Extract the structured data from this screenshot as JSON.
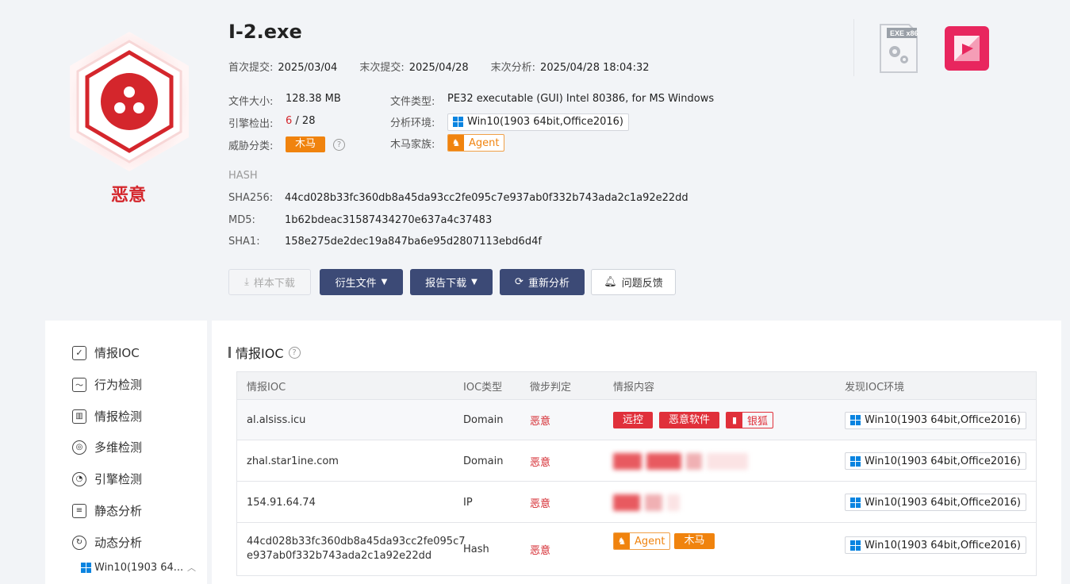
{
  "file": {
    "name": "I-2.exe",
    "verdict": "恶意",
    "first_submit_label": "首次提交:",
    "first_submit": "2025/03/04",
    "last_submit_label": "末次提交:",
    "last_submit": "2025/04/28",
    "last_analysis_label": "末次分析:",
    "last_analysis": "2025/04/28 18:04:32",
    "size_label": "文件大小:",
    "size": "128.38 MB",
    "engines_label": "引擎检出:",
    "engines_detected": "6",
    "engines_total": "/ 28",
    "threat_label": "威胁分类:",
    "threat": "木马",
    "type_label": "文件类型:",
    "type": "PE32 executable (GUI) Intel 80386, for MS Windows",
    "env_label": "分析环境:",
    "env": "Win10(1903 64bit,Office2016)",
    "family_label": "木马家族:",
    "family": "Agent"
  },
  "hash": {
    "title": "HASH",
    "sha256_label": "SHA256:",
    "sha256": "44cd028b33fc360db8a45da93cc2fe095c7e937ab0f332b743ada2c1a92e22dd",
    "md5_label": "MD5:",
    "md5": "1b62bdeac31587434270e637a4c37483",
    "sha1_label": "SHA1:",
    "sha1": "158e275de2dec19a847ba6e95d2807113ebd6d4f"
  },
  "actions": {
    "download_sample": "样本下载",
    "derived_files": "衍生文件",
    "report_download": "报告下载",
    "reanalyze": "重新分析",
    "feedback": "问题反馈"
  },
  "sidebar": {
    "items": [
      {
        "label": "情报IOC"
      },
      {
        "label": "行为检测"
      },
      {
        "label": "情报检测"
      },
      {
        "label": "多维检测"
      },
      {
        "label": "引擎检测"
      },
      {
        "label": "静态分析"
      },
      {
        "label": "动态分析"
      }
    ],
    "sub_env": "Win10(1903 64..."
  },
  "ioc": {
    "section_title": "情报IOC",
    "headers": [
      "情报IOC",
      "IOC类型",
      "微步判定",
      "情报内容",
      "发现IOC环境"
    ],
    "rows": [
      {
        "ioc": "al.alsiss.icu",
        "type": "Domain",
        "verdict": "恶意",
        "tags": [
          "远控",
          "恶意软件"
        ],
        "tag_out": "银狐",
        "env": "Win10(1903 64bit,Office2016)"
      },
      {
        "ioc": "zhal.star1ine.com",
        "type": "Domain",
        "verdict": "恶意",
        "env": "Win10(1903 64bit,Office2016)"
      },
      {
        "ioc": "154.91.64.74",
        "type": "IP",
        "verdict": "恶意",
        "env": "Win10(1903 64bit,Office2016)"
      },
      {
        "ioc_line1": "44cd028b33fc360db8a45da93cc2fe095c7",
        "ioc_line2": "e937ab0f332b743ada2c1a92e22dd",
        "type": "Hash",
        "verdict": "恶意",
        "agent": "Agent",
        "trojan": "木马",
        "env": "Win10(1903 64bit,Office2016)"
      }
    ]
  },
  "colors": {
    "danger": "#d4262c",
    "primary_btn": "#3c4a76",
    "orange": "#f0830e",
    "win_blue": "#0a84e0"
  }
}
